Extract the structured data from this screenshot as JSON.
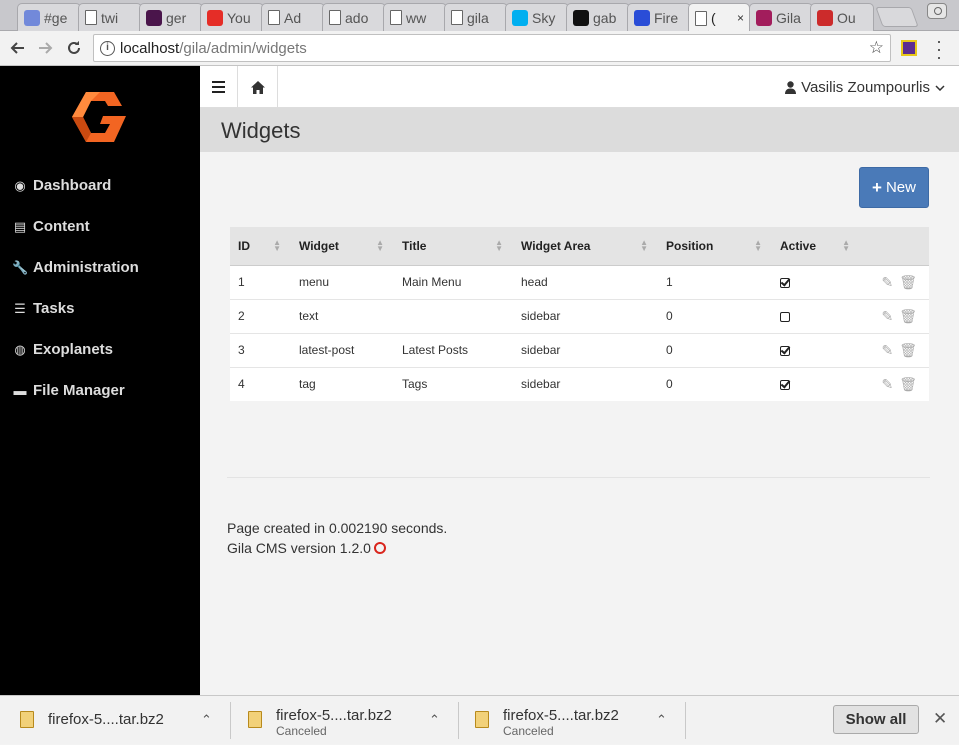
{
  "browser": {
    "tabs": [
      {
        "label": "#ge",
        "icon": "discord-icon",
        "color": "#7289da"
      },
      {
        "label": "twi",
        "icon": "page-icon"
      },
      {
        "label": "ger",
        "icon": "slack-icon",
        "color": "#4a154b"
      },
      {
        "label": "You",
        "icon": "youtube-icon",
        "color": "#e52d27"
      },
      {
        "label": "Ad",
        "icon": "page-icon"
      },
      {
        "label": "ado",
        "icon": "page-icon"
      },
      {
        "label": "ww",
        "icon": "page-icon"
      },
      {
        "label": "gila",
        "icon": "page-icon"
      },
      {
        "label": "Sky",
        "icon": "skype-icon",
        "color": "#00aff0"
      },
      {
        "label": "gab",
        "icon": "github-icon",
        "color": "#111111"
      },
      {
        "label": "Fire",
        "icon": "firefox-icon",
        "color": "#2a4dd7"
      },
      {
        "label": "(",
        "icon": "page-icon",
        "active": true
      },
      {
        "label": "Gila",
        "icon": "gila-icon",
        "color": "#a21d5c"
      },
      {
        "label": "Ou",
        "icon": "outlook-icon",
        "color": "#cc2b2b"
      }
    ],
    "url_host": "localhost",
    "url_path": "/gila/admin/widgets",
    "info_glyph": "i",
    "star_glyph": "☆"
  },
  "sidebar": {
    "items": [
      {
        "label": "Dashboard",
        "icon": "dashboard-icon",
        "glyph": "◉"
      },
      {
        "label": "Content",
        "icon": "newspaper-icon",
        "glyph": "▤"
      },
      {
        "label": "Administration",
        "icon": "wrench-icon",
        "glyph": "🔧"
      },
      {
        "label": "Tasks",
        "icon": "tasks-icon",
        "glyph": "☰"
      },
      {
        "label": "Exoplanets",
        "icon": "globe-icon",
        "glyph": "◍"
      },
      {
        "label": "File Manager",
        "icon": "folder-icon",
        "glyph": "▬"
      }
    ]
  },
  "topbar": {
    "user_name": "Vasilis Zoumpourlis",
    "user_glyph": "👤",
    "home_glyph": "⌂",
    "chevron_glyph": "⌄"
  },
  "page": {
    "title": "Widgets",
    "new_button": "New",
    "plus_glyph": "+"
  },
  "table": {
    "columns": [
      "ID",
      "Widget",
      "Title",
      "Widget Area",
      "Position",
      "Active"
    ],
    "rows": [
      {
        "id": "1",
        "widget": "menu",
        "title": "Main Menu",
        "area": "head",
        "position": "1",
        "active": true
      },
      {
        "id": "2",
        "widget": "text",
        "title": "",
        "area": "sidebar",
        "position": "0",
        "active": false
      },
      {
        "id": "3",
        "widget": "latest-post",
        "title": "Latest Posts",
        "area": "sidebar",
        "position": "0",
        "active": true
      },
      {
        "id": "4",
        "widget": "tag",
        "title": "Tags",
        "area": "sidebar",
        "position": "0",
        "active": true
      }
    ],
    "edit_glyph": "✎",
    "delete_glyph": "🗑"
  },
  "footer": {
    "created": "Page created in 0.002190 seconds.",
    "version": "Gila CMS version 1.2.0"
  },
  "downloads": {
    "items": [
      {
        "name": "firefox-5....tar.bz2",
        "status": ""
      },
      {
        "name": "firefox-5....tar.bz2",
        "status": "Canceled"
      },
      {
        "name": "firefox-5....tar.bz2",
        "status": "Canceled"
      }
    ],
    "show_all": "Show all",
    "close_glyph": "✕",
    "caret_glyph": "⌃"
  },
  "colors": {
    "sidebar_bg": "#000000",
    "accent_blue": "#4a7ab8",
    "logo_orange": "#f26522",
    "github_red": "#d9251c"
  }
}
